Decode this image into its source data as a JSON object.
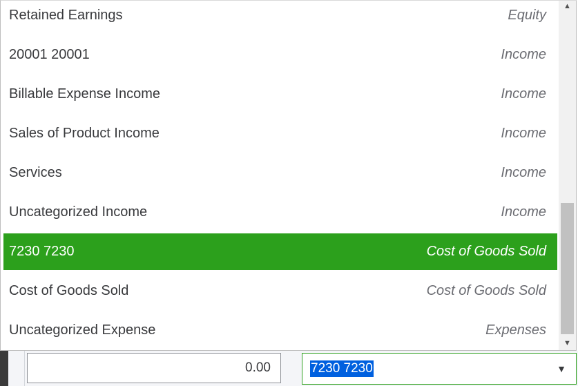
{
  "accounts": [
    {
      "name": "Retained Earnings",
      "type": "Equity",
      "selected": false
    },
    {
      "name": "20001 20001",
      "type": "Income",
      "selected": false
    },
    {
      "name": "Billable Expense Income",
      "type": "Income",
      "selected": false
    },
    {
      "name": "Sales of Product Income",
      "type": "Income",
      "selected": false
    },
    {
      "name": "Services",
      "type": "Income",
      "selected": false
    },
    {
      "name": "Uncategorized Income",
      "type": "Income",
      "selected": false
    },
    {
      "name": "7230 7230",
      "type": "Cost of Goods Sold",
      "selected": true
    },
    {
      "name": "Cost of Goods Sold",
      "type": "Cost of Goods Sold",
      "selected": false
    },
    {
      "name": "Uncategorized Expense",
      "type": "Expenses",
      "selected": false
    }
  ],
  "amount": {
    "value": "0.00"
  },
  "account_field": {
    "value": "7230 7230",
    "arrow_icon": "caret-down-icon"
  },
  "scrollbar": {
    "up_icon": "scroll-up-arrow",
    "down_icon": "scroll-down-arrow"
  },
  "colors": {
    "selected_row": "#2ca01c",
    "text_highlight": "#0060df",
    "focus_border": "#2ca01c"
  }
}
